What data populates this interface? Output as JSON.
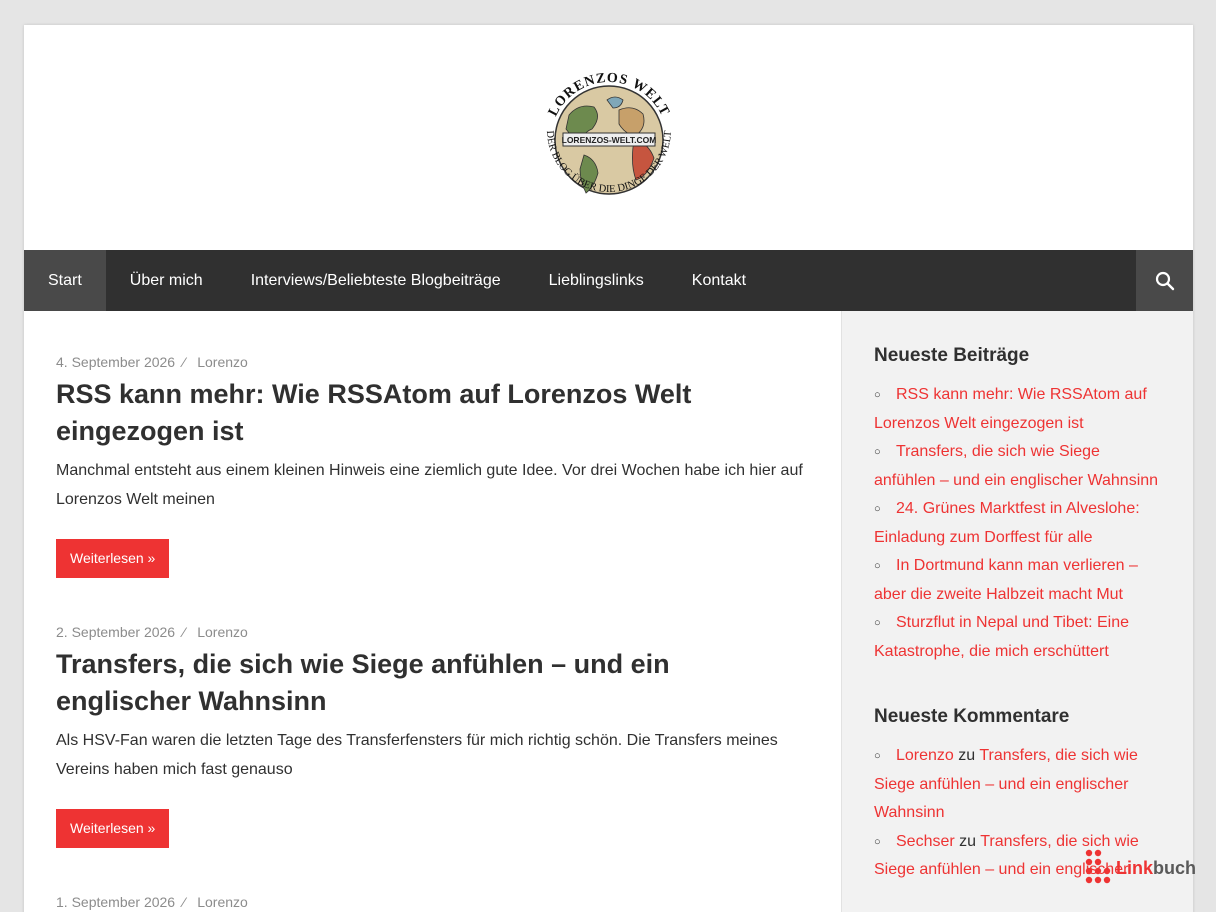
{
  "logo": {
    "top_text": "LORENZOS WELT",
    "banner_text": "LORENZOS-WELT.COM",
    "bottom_text": "DER BLOG ÜBER DIE DINGE DER WELT"
  },
  "nav": {
    "items": [
      {
        "label": "Start"
      },
      {
        "label": "Über mich"
      },
      {
        "label": "Interviews/Beliebteste Blogbeiträge"
      },
      {
        "label": "Lieblingslinks"
      },
      {
        "label": "Kontakt"
      }
    ]
  },
  "posts": [
    {
      "date": "4. September 2026",
      "sep": "⁄",
      "author": "Lorenzo",
      "title": "RSS kann mehr: Wie RSSAtom auf Lorenzos Welt eingezogen ist",
      "excerpt": "Manchmal entsteht aus einem kleinen Hinweis eine ziemlich gute Idee. Vor drei Wochen habe ich hier auf Lorenzos Welt meinen",
      "button": "Weiterlesen »"
    },
    {
      "date": "2. September 2026",
      "sep": "⁄",
      "author": "Lorenzo",
      "title": "Transfers, die sich wie Siege anfühlen – und ein englischer Wahnsinn",
      "excerpt": "Als HSV-Fan waren die letzten Tage des Transferfensters für mich richtig schön. Die Transfers meines Vereins haben mich fast genauso",
      "button": "Weiterlesen »"
    },
    {
      "date": "1. September 2026",
      "sep": "⁄",
      "author": "Lorenzo"
    }
  ],
  "sidebar": {
    "recent_posts": {
      "title": "Neueste Beiträge",
      "items": [
        "RSS kann mehr: Wie RSSAtom auf Lorenzos Welt eingezogen ist",
        "Transfers, die sich wie Siege anfühlen – und ein englischer Wahnsinn",
        "24. Grünes Marktfest in Alveslohe: Einladung zum Dorffest für alle",
        "In Dortmund kann man verlieren – aber die zweite Halbzeit macht Mut",
        "Sturzflut in Nepal und Tibet: Eine Katastrophe, die mich erschüttert"
      ]
    },
    "recent_comments": {
      "title": "Neueste Kommentare",
      "items": [
        {
          "author": "Lorenzo",
          "joiner": "zu",
          "post": "Transfers, die sich wie Siege anfühlen – und ein englischer Wahnsinn"
        },
        {
          "author": "Sechser",
          "joiner": "zu",
          "post": "Transfers, die sich wie Siege anfühlen – und ein englischer"
        }
      ]
    }
  },
  "badge": {
    "part1": "Link",
    "part2": "buch"
  },
  "colors": {
    "accent": "#ee3333",
    "nav_bg": "#303030",
    "nav_active": "#494949"
  }
}
